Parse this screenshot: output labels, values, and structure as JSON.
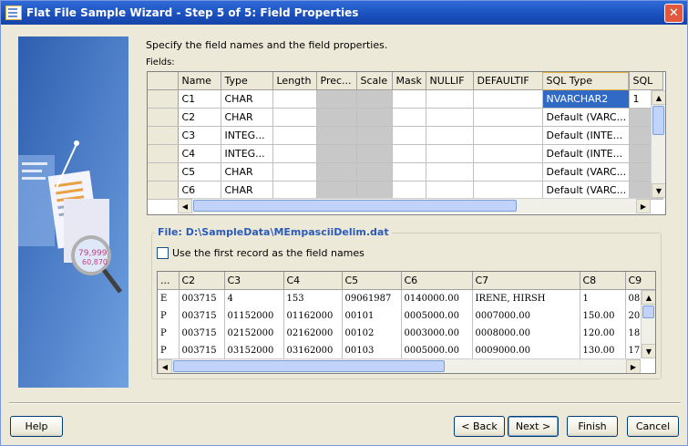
{
  "window": {
    "title": "Flat File Sample Wizard - Step 5 of 5: Field Properties"
  },
  "instruction": "Specify the field names and the field properties.",
  "fields_label": "Fields:",
  "fields_table": {
    "columns": [
      "Name",
      "Type",
      "Length",
      "Prec...",
      "Scale",
      "Mask",
      "NULLIF",
      "DEFAULTIF",
      "SQL Type",
      "SQL"
    ],
    "rows": [
      {
        "name": "C1",
        "type": "CHAR",
        "sql_type": "NVARCHAR2",
        "sql": "1"
      },
      {
        "name": "C2",
        "type": "CHAR",
        "sql_type": "Default (VARC...",
        "sql": ""
      },
      {
        "name": "C3",
        "type": "INTEG...",
        "sql_type": "Default (INTE...",
        "sql": ""
      },
      {
        "name": "C4",
        "type": "INTEG...",
        "sql_type": "Default (INTE...",
        "sql": ""
      },
      {
        "name": "C5",
        "type": "CHAR",
        "sql_type": "Default (VARC...",
        "sql": ""
      },
      {
        "name": "C6",
        "type": "CHAR",
        "sql_type": "Default (VARC...",
        "sql": ""
      }
    ]
  },
  "file_group": {
    "title": "File: D:\\SampleData\\MEmpasciiDelim.dat",
    "checkbox_label": "Use the first record as the field names",
    "checkbox_checked": false
  },
  "sample_table": {
    "columns": [
      "...",
      "C2",
      "C3",
      "C4",
      "C5",
      "C6",
      "C7",
      "C8",
      "C9"
    ],
    "rows": [
      [
        "E",
        "003715",
        "4",
        "153",
        "09061987",
        "0140000.00",
        "IRENE, HIRSH",
        "1",
        "08"
      ],
      [
        "P",
        "003715",
        "01152000",
        "01162000",
        "00101",
        "0005000.00",
        "0007000.00",
        "150.00",
        "20"
      ],
      [
        "P",
        "003715",
        "02152000",
        "02162000",
        "00102",
        "0003000.00",
        "0008000.00",
        "120.00",
        "18"
      ],
      [
        "P",
        "003715",
        "03152000",
        "03162000",
        "00103",
        "0005000.00",
        "0009000.00",
        "130.00",
        "17"
      ]
    ]
  },
  "buttons": {
    "help": "Help",
    "back": "< Back",
    "next": "Next >",
    "finish": "Finish",
    "cancel": "Cancel"
  },
  "icons": {
    "close": "close-icon",
    "title_icon": "wizard-icon",
    "side_image": "wizard-illustration"
  },
  "colors": {
    "title_bar": "#1a4fbd",
    "selection": "#316ac5",
    "group_title": "#2c5ab8"
  }
}
